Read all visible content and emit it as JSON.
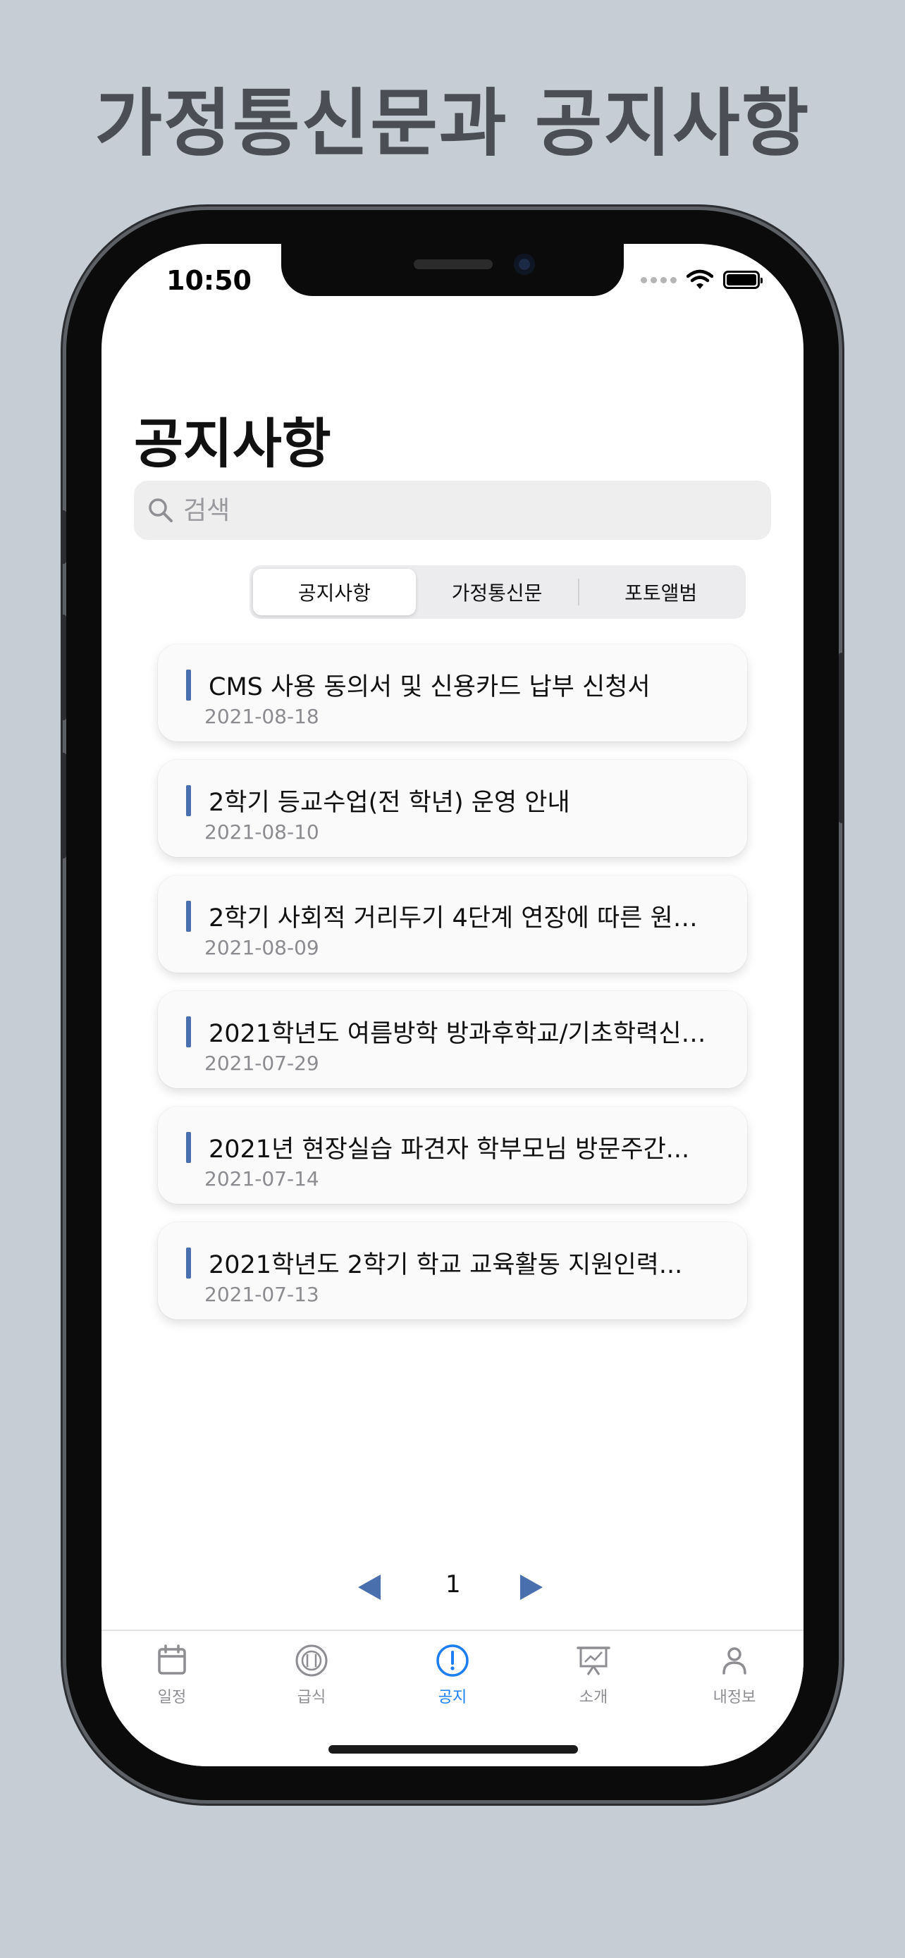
{
  "promo": {
    "title": "가정통신문과 공지사항"
  },
  "status_bar": {
    "time": "10:50"
  },
  "page": {
    "title": "공지사항"
  },
  "search": {
    "placeholder": "검색"
  },
  "segments": [
    {
      "label": "공지사항",
      "selected": true
    },
    {
      "label": "가정통신문",
      "selected": false
    },
    {
      "label": "포토앨범",
      "selected": false
    }
  ],
  "notices": [
    {
      "title": "CMS 사용 동의서 및 신용카드 납부 신청서",
      "date": "2021-08-18"
    },
    {
      "title": "2학기 등교수업(전 학년) 운영 안내",
      "date": "2021-08-10"
    },
    {
      "title": "2학기 사회적 거리두기 4단계 연장에 따른 원…",
      "date": "2021-08-09"
    },
    {
      "title": "2021학년도 여름방학 방과후학교/기초학력신…",
      "date": "2021-07-29"
    },
    {
      "title": "2021년 현장실습 파견자 학부모님 방문주간...",
      "date": "2021-07-14"
    },
    {
      "title": "2021학년도 2학기 학교 교육활동 지원인력...",
      "date": "2021-07-13"
    }
  ],
  "pagination": {
    "current_page": "1"
  },
  "tabs": [
    {
      "label": "일정",
      "icon": "calendar-icon",
      "active": false
    },
    {
      "label": "급식",
      "icon": "meal-icon",
      "active": false
    },
    {
      "label": "공지",
      "icon": "notice-icon",
      "active": true
    },
    {
      "label": "소개",
      "icon": "presentation-icon",
      "active": false
    },
    {
      "label": "내정보",
      "icon": "person-icon",
      "active": false
    }
  ],
  "colors": {
    "accent": "#4a6fad",
    "tab_active": "#1d7ef0",
    "tab_inactive": "#8d8d92",
    "background": "#c6cdd5"
  }
}
